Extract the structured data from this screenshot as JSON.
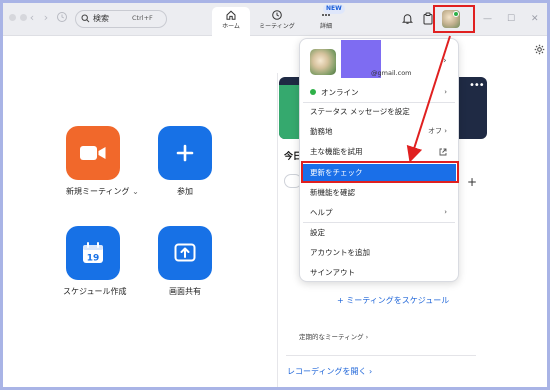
{
  "titlebar": {
    "search_label": "検索",
    "search_shortcut": "Ctrl+F",
    "tabs": [
      {
        "label": "ホーム"
      },
      {
        "label": "ミーティング"
      },
      {
        "label": "詳細"
      }
    ],
    "new_badge": "NEW"
  },
  "main": {
    "tiles": [
      {
        "label": "新規ミーティング",
        "color": "#f1682b",
        "icon": "video-camera-icon"
      },
      {
        "label": "参加",
        "color": "#1771e6",
        "icon": "plus-icon"
      },
      {
        "label": "スケジュール作成",
        "color": "#1771e6",
        "icon": "calendar-icon",
        "calendar_day": "19"
      },
      {
        "label": "画面共有",
        "color": "#1771e6",
        "icon": "share-up-arrow-icon"
      }
    ],
    "dropdown_caret": "⌄"
  },
  "right_panel": {
    "today_label": "今日",
    "schedule_link": "+ ミーティングをスケジュール",
    "recurring_label": "定期的なミーティング ›",
    "recordings_link": "レコーディングを開く ›"
  },
  "menu": {
    "email": "@gmail.com",
    "status": "オンライン",
    "items": [
      {
        "label": "ステータス メッセージを設定"
      },
      {
        "label": "勤務地",
        "right": "オフ ›"
      },
      {
        "label": "主な機能を試用"
      },
      {
        "label": "更新をチェック",
        "highlighted": true
      },
      {
        "label": "新機能を確認"
      },
      {
        "label": "ヘルプ",
        "right": "›"
      },
      {
        "label": "設定"
      },
      {
        "label": "アカウントを追加"
      },
      {
        "label": "サインアウト"
      }
    ]
  },
  "colors": {
    "accent": "#1a6fe8",
    "annotation": "#e02020",
    "online": "#2eb148"
  }
}
